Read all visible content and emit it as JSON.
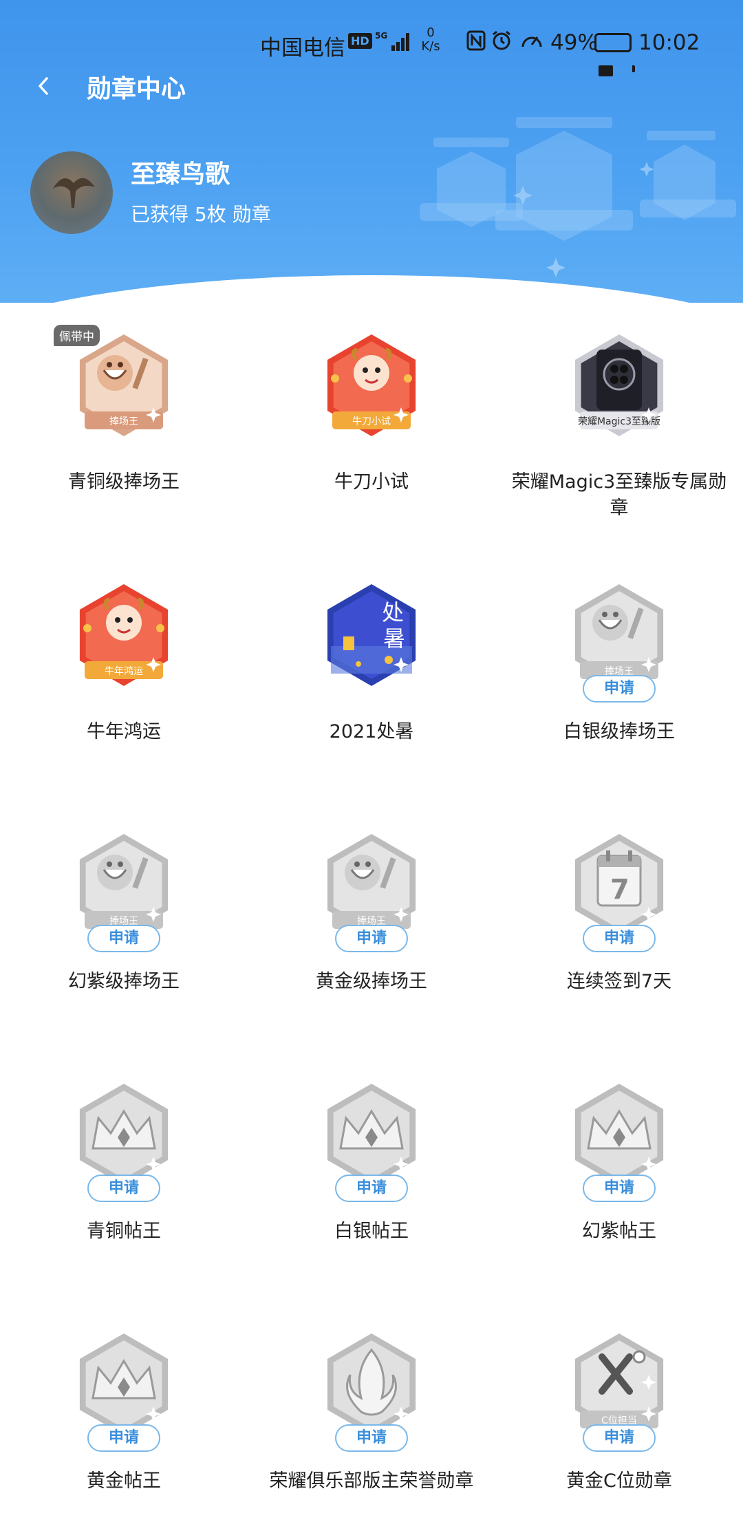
{
  "status_bar": {
    "carrier": "中国电信",
    "hd": "HD",
    "network": "5G",
    "speed_value": "0",
    "speed_unit": "K/s",
    "battery_pct": "49%",
    "battery_level": 0.49,
    "time": "10:02",
    "icons": [
      "nfc-icon",
      "alarm-icon",
      "speed-gauge-icon"
    ]
  },
  "nav": {
    "title": "勋章中心",
    "back_icon": "chevron-left-icon"
  },
  "profile": {
    "username": "至臻鸟歌",
    "medal_count": "已获得 5枚 勋章"
  },
  "badge_tag": "佩带中",
  "apply_label": "申请",
  "badges": [
    {
      "label": "青铜级捧场王",
      "state": "earned",
      "wearing": true,
      "style": "bronze",
      "ribbon": "捧场王"
    },
    {
      "label": "牛刀小试",
      "state": "earned",
      "wearing": false,
      "style": "red",
      "ribbon": "牛刀小试"
    },
    {
      "label": "荣耀Magic3至臻版专属勋章",
      "state": "earned",
      "wearing": false,
      "style": "phone",
      "ribbon": "荣耀Magic3至臻版"
    },
    {
      "label": "牛年鸿运",
      "state": "earned",
      "wearing": false,
      "style": "red",
      "ribbon": "牛年鸿运"
    },
    {
      "label": "2021处暑",
      "state": "earned",
      "wearing": false,
      "style": "night",
      "ribbon": "处暑"
    },
    {
      "label": "白银级捧场王",
      "state": "locked",
      "wearing": false,
      "style": "grey",
      "ribbon": "捧场王"
    },
    {
      "label": "幻紫级捧场王",
      "state": "locked",
      "wearing": false,
      "style": "grey",
      "ribbon": "捧场王"
    },
    {
      "label": "黄金级捧场王",
      "state": "locked",
      "wearing": false,
      "style": "grey",
      "ribbon": "捧场王"
    },
    {
      "label": "连续签到7天",
      "state": "locked",
      "wearing": false,
      "style": "grey-calendar",
      "ribbon": "7"
    },
    {
      "label": "青铜帖王",
      "state": "locked",
      "wearing": false,
      "style": "grey-crown",
      "ribbon": ""
    },
    {
      "label": "白银帖王",
      "state": "locked",
      "wearing": false,
      "style": "grey-crown",
      "ribbon": ""
    },
    {
      "label": "幻紫帖王",
      "state": "locked",
      "wearing": false,
      "style": "grey-crown",
      "ribbon": ""
    },
    {
      "label": "黄金帖王",
      "state": "locked",
      "wearing": false,
      "style": "grey-crown",
      "ribbon": ""
    },
    {
      "label": "荣耀俱乐部版主荣誉勋章",
      "state": "locked",
      "wearing": false,
      "style": "grey-flame",
      "ribbon": ""
    },
    {
      "label": "黄金C位勋章",
      "state": "locked",
      "wearing": false,
      "style": "grey-star",
      "ribbon": "C位担当"
    }
  ],
  "colors": {
    "header_blue": "#4ea2f2",
    "apply_border": "#79b8ea",
    "apply_text": "#3b8fdc"
  }
}
